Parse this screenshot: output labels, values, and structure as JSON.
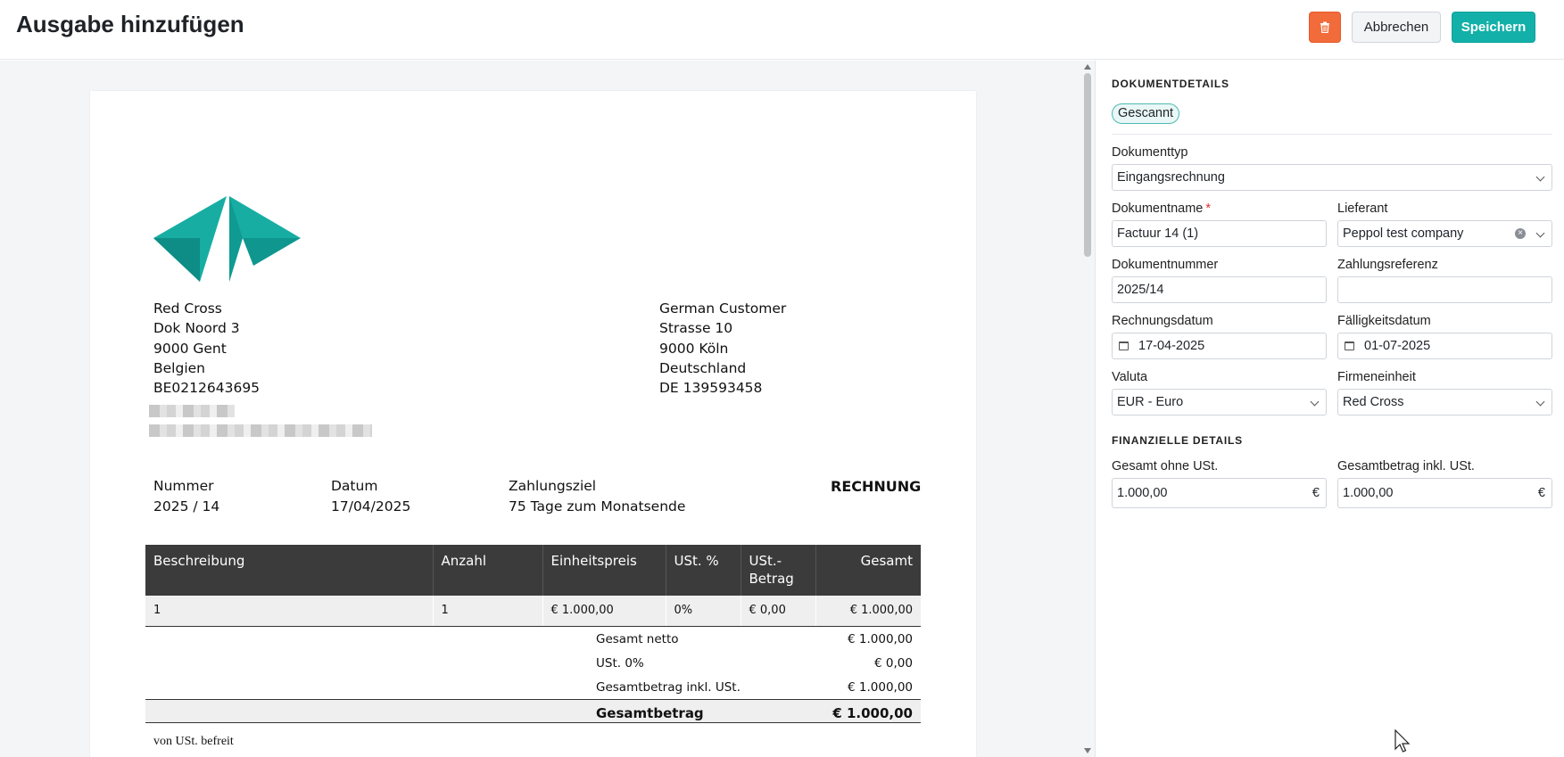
{
  "header": {
    "title": "Ausgabe hinzufügen",
    "delete_icon": "trash-icon",
    "cancel_label": "Abbrechen",
    "save_label": "Speichern",
    "colors": {
      "delete": "#f26b3a",
      "save": "#12b0a8"
    }
  },
  "document": {
    "sender": [
      "Red Cross",
      "Dok Noord 3",
      "9000 Gent",
      "Belgien",
      "BE0212643695"
    ],
    "recipient": [
      "German Customer",
      "Strasse 10",
      "9000 Köln",
      "Deutschland",
      "DE 139593458"
    ],
    "meta": [
      {
        "label": "Nummer",
        "value": "2025 / 14"
      },
      {
        "label": "Datum",
        "value": "17/04/2025"
      },
      {
        "label": "Zahlungsziel",
        "value": "75 Tage zum Monatsende"
      }
    ],
    "doc_title": "RECHNUNG",
    "table_headers": [
      "Beschreibung",
      "Anzahl",
      "Einheitspreis",
      "USt. %",
      "USt.-Betrag",
      "Gesamt"
    ],
    "table_rows": [
      [
        "1",
        "1",
        "€ 1.000,00",
        "0%",
        "€ 0,00",
        "€ 1.000,00"
      ]
    ],
    "totals": [
      {
        "label": "Gesamt netto",
        "value": "€ 1.000,00"
      },
      {
        "label": "USt. 0%",
        "value": "€ 0,00"
      },
      {
        "label": "Gesamtbetrag inkl. USt.",
        "value": "€ 1.000,00"
      }
    ],
    "grand_total": {
      "label": "Gesamtbetrag",
      "value": "€ 1.000,00"
    },
    "footnote": "von USt. befreit"
  },
  "sidebar": {
    "doc_section_title": "DOKUMENTDETAILS",
    "status_chip": "Gescannt",
    "fields": {
      "doc_type": {
        "label": "Dokumenttyp",
        "value": "Eingangsrechnung"
      },
      "doc_name": {
        "label": "Dokumentname",
        "required_mark": "*",
        "value": "Factuur 14 (1)"
      },
      "supplier": {
        "label": "Lieferant",
        "value": "Peppol test company"
      },
      "doc_number": {
        "label": "Dokumentnummer",
        "value": "2025/14"
      },
      "payment_ref": {
        "label": "Zahlungsreferenz",
        "value": ""
      },
      "invoice_date": {
        "label": "Rechnungsdatum",
        "value": "17-04-2025"
      },
      "due_date": {
        "label": "Fälligkeitsdatum",
        "value": "01-07-2025"
      },
      "currency": {
        "label": "Valuta",
        "value": "EUR - Euro"
      },
      "company_unit": {
        "label": "Firmeneinheit",
        "value": "Red Cross"
      }
    },
    "fin_section_title": "FINANZIELLE DETAILS",
    "financial": {
      "net": {
        "label": "Gesamt ohne USt.",
        "value": "1.000,00",
        "currency": "€"
      },
      "gross": {
        "label": "Gesamtbetrag inkl. USt.",
        "value": "1.000,00",
        "currency": "€"
      }
    }
  }
}
